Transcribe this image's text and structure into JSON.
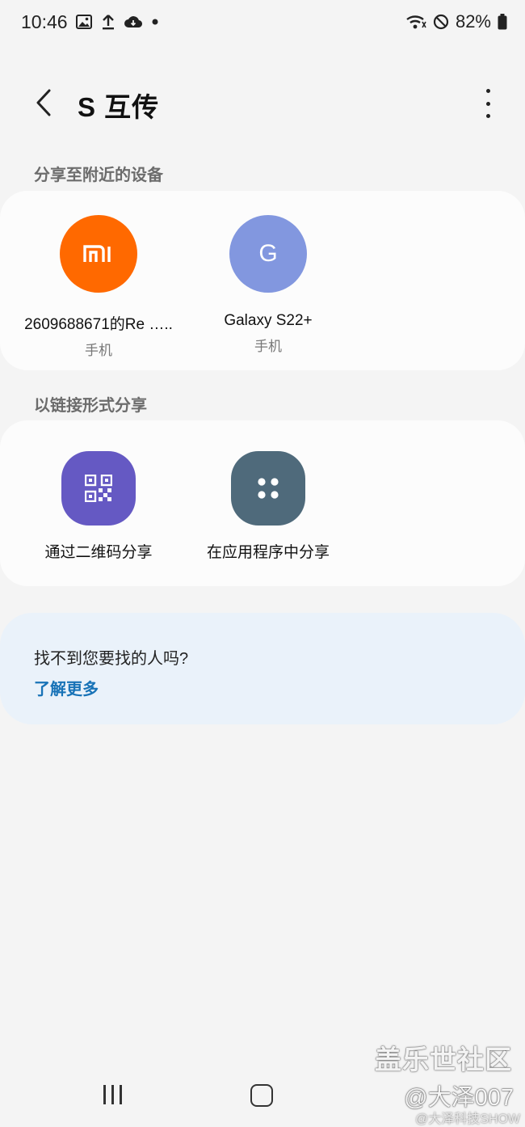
{
  "status_bar": {
    "time": "10:46",
    "battery": "82%"
  },
  "app_bar": {
    "title": "S 互传"
  },
  "nearby": {
    "section_title": "分享至附近的设备",
    "devices": [
      {
        "avatar_text": "mi",
        "name": "2609688671的Re  …..",
        "type": "手机",
        "color": "#ff6900"
      },
      {
        "avatar_text": "G",
        "name": "Galaxy S22+",
        "type": "手机",
        "color": "#8297df"
      }
    ]
  },
  "link_share": {
    "section_title": "以链接形式分享",
    "options": [
      {
        "label": "通过二维码分享",
        "icon": "qr-code-icon",
        "color": "#6559c3"
      },
      {
        "label": "在应用程序中分享",
        "icon": "app-grid-icon",
        "color": "#4f6a7b"
      }
    ]
  },
  "help": {
    "question": "找不到您要找的人吗?",
    "link": "了解更多"
  },
  "watermark": {
    "main": "盖乐世社区",
    "sub": "@大泽007",
    "weibo": "@大泽科技SHOW"
  },
  "accent_colors": {
    "link": "#1873b7",
    "help_bg": "#eaf2fa"
  }
}
